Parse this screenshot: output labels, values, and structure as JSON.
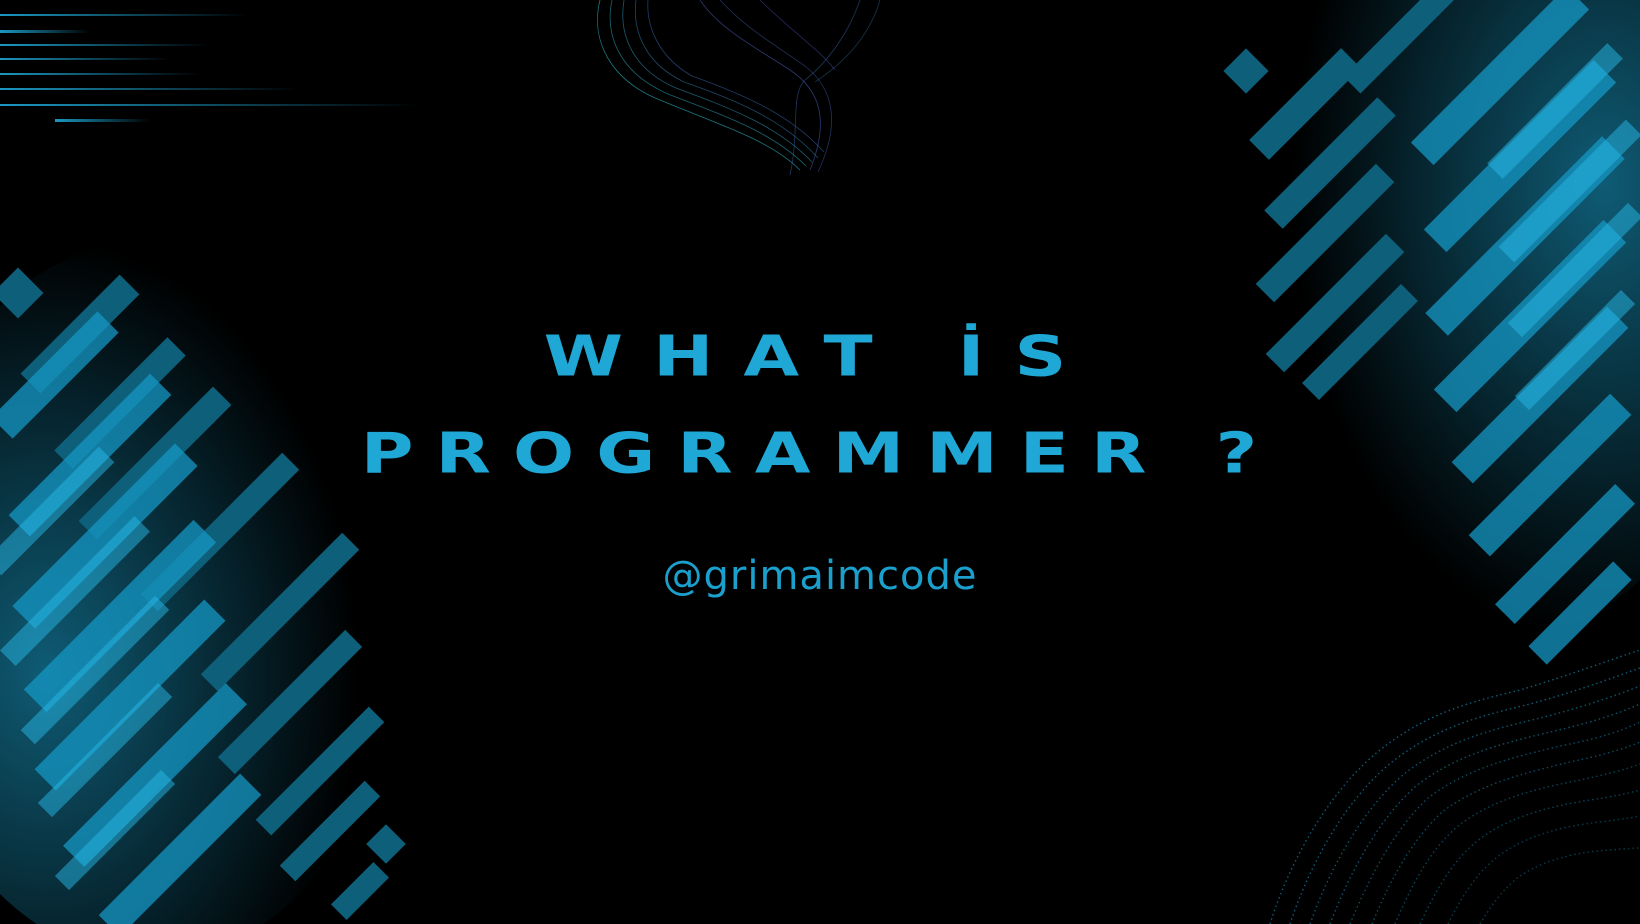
{
  "slide": {
    "title_line1": "WHAT İS",
    "title_line2": "PROGRAMMER ?",
    "handle": "@grimaimcode"
  },
  "colors": {
    "background": "#000000",
    "accent": "#1fa8d6",
    "glitch_dark": "#0b4d63",
    "glitch_light": "#20b4e0"
  }
}
